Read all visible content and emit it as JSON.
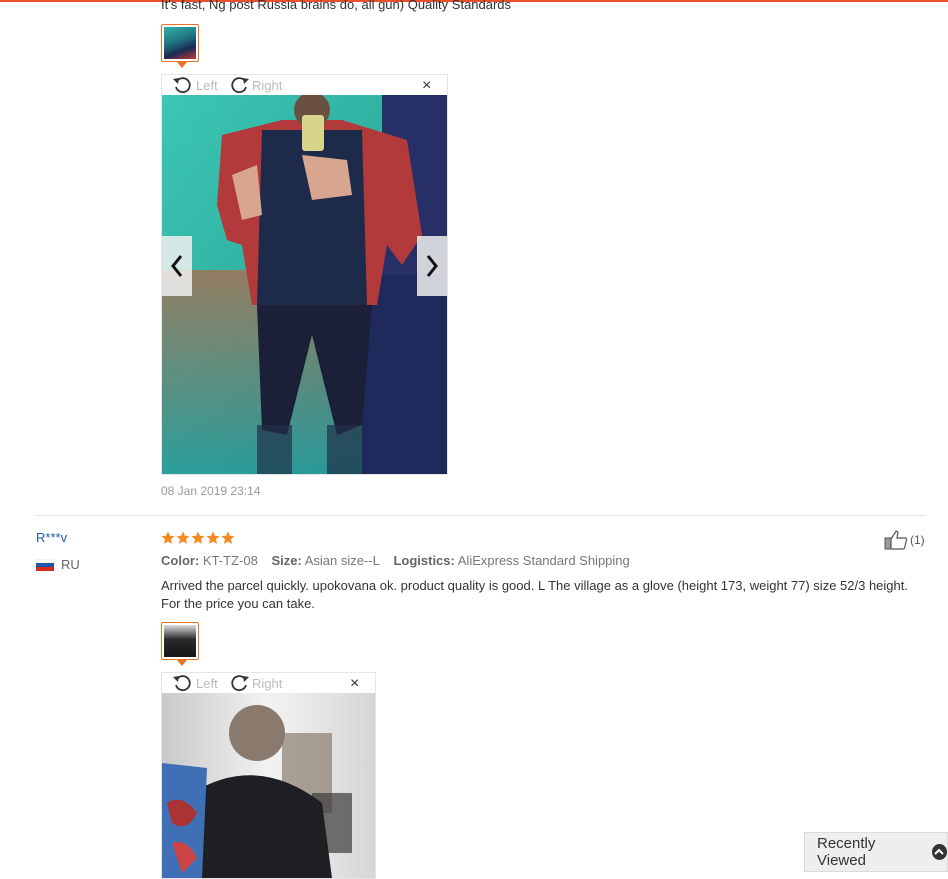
{
  "review1": {
    "text_partial": "It's fast, Ng post Russia brains do, all gun) Quality Standards",
    "rotate_left": "Left",
    "rotate_right": "Right",
    "close": "×",
    "date": "08 Jan 2019 23:14"
  },
  "review2": {
    "username": "R***v",
    "country": "RU",
    "rating": 5,
    "helpful_count": "(1)",
    "color_label": "Color:",
    "color_value": "KT-TZ-08",
    "size_label": "Size:",
    "size_value": "Asian size--L",
    "logistics_label": "Logistics:",
    "logistics_value": "AliExpress Standard Shipping",
    "text": "Arrived the parcel quickly. upokovana ok. product quality is good. L The village as a glove (height 173, weight 77) size 52/3 height. For the price you can take.",
    "rotate_left": "Left",
    "rotate_right": "Right",
    "close": "×"
  },
  "recently_viewed": {
    "label": "Recently Viewed"
  },
  "colors": {
    "accent": "#e8502e",
    "star": "#f38a22",
    "link": "#1a5dab"
  }
}
